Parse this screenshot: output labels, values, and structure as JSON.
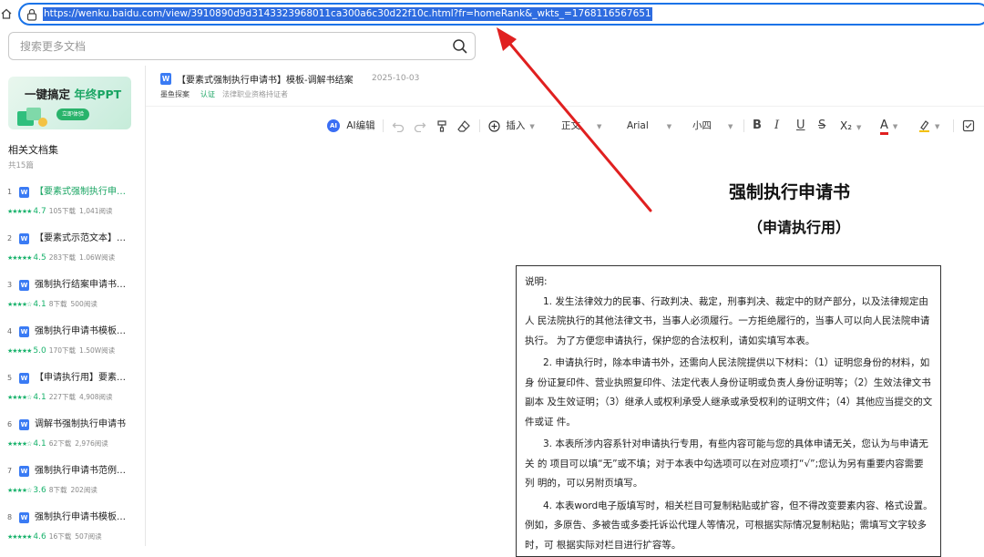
{
  "browser": {
    "url": "https://wenku.baidu.com/view/3910890d9d3143323968011ca300a6c30d22f10c.html?fr=homeRank&_wkts_=1768116567651"
  },
  "search": {
    "placeholder": "搜索更多文档"
  },
  "sidebar": {
    "banner": {
      "title_prefix": "一键搞定 ",
      "title_accent": "年终PPT",
      "button": "立即体验"
    },
    "related_title": "相关文档集",
    "related_count": "共15篇",
    "items": [
      {
        "num": "1",
        "title": "【要素式强制执行申…",
        "stars": "★★★★★",
        "rating": "4.7",
        "downloads": "105下载",
        "reads": "1,041阅读",
        "active": true
      },
      {
        "num": "2",
        "title": "【要素式示范文本】…",
        "stars": "★★★★★",
        "rating": "4.5",
        "downloads": "283下载",
        "reads": "1.06W阅读",
        "active": false
      },
      {
        "num": "3",
        "title": "强制执行结案申请书…",
        "stars": "★★★★☆",
        "rating": "4.1",
        "downloads": "8下载",
        "reads": "500阅读",
        "active": false
      },
      {
        "num": "4",
        "title": "强制执行申请书模板…",
        "stars": "★★★★★",
        "rating": "5.0",
        "downloads": "170下载",
        "reads": "1.50W阅读",
        "active": false
      },
      {
        "num": "5",
        "title": "【申请执行用】要素…",
        "stars": "★★★★☆",
        "rating": "4.1",
        "downloads": "227下载",
        "reads": "4,908阅读",
        "active": false
      },
      {
        "num": "6",
        "title": "调解书强制执行申请书",
        "stars": "★★★★☆",
        "rating": "4.1",
        "downloads": "62下载",
        "reads": "2,976阅读",
        "active": false
      },
      {
        "num": "7",
        "title": "强制执行申请书范例…",
        "stars": "★★★★☆",
        "rating": "3.6",
        "downloads": "8下载",
        "reads": "202阅读",
        "active": false
      },
      {
        "num": "8",
        "title": "强制执行申请书模板…",
        "stars": "★★★★★",
        "rating": "4.6",
        "downloads": "16下载",
        "reads": "507阅读",
        "active": false
      }
    ]
  },
  "doc_header": {
    "type_icon": "W",
    "title": "【要素式强制执行申请书】模板-调解书结案",
    "date": "2025-10-03",
    "author": "墨鱼探案",
    "badge": "认证",
    "cert": "法律职业资格持证者"
  },
  "toolbar": {
    "ai_label": "AI编辑",
    "insert": "插入",
    "style": "正文",
    "font": "Arial",
    "size": "小四",
    "bold": "B",
    "italic": "I",
    "underline": "U",
    "strike": "S",
    "subscript": "X₂",
    "font_color": "A"
  },
  "document": {
    "heading": "强制执行申请书",
    "subheading": "（申请执行用）",
    "instructions_label": "说明:",
    "paragraphs": [
      "1. 发生法律效力的民事、行政判决、裁定，刑事判决、裁定中的财产部分，以及法律规定由人  民法院执行的其他法律文书，当事人必须履行。一方拒绝履行的，当事人可以向人民法院申请执行。 为了方便您申请执行，保护您的合法权利，请如实填写本表。",
      "2. 申请执行时，除本申请书外，还需向人民法院提供以下材料：（1）证明您身份的材料，如身 份证复印件、营业执照复印件、法定代表人身份证明或负责人身份证明等；（2）生效法律文书副本 及生效证明；（3）继承人或权利承受人继承或承受权利的证明文件；（4）其他应当提交的文件或证 件。",
      "3. 本表所涉内容系针对申请执行专用，有些内容可能与您的具体申请无关，您认为与申请无关 的 项目可以填“无”或不填；对于本表中勾选项可以在对应项打“√”;您认为另有重要内容需要列 明的，可以另附页填写。",
      "4. 本表word电子版填写时，相关栏目可复制粘贴或扩容，但不得改变要素内容、格式设置。例如，多原告、多被告或多委托诉讼代理人等情况，可根据实际情况复制粘贴；需填写文字较多时，可 根据实际对栏目进行扩容等。"
    ]
  },
  "colors": {
    "accent_green": "#1aa563",
    "url_highlight": "#2e6ce0",
    "annotation_red": "#e02020"
  },
  "icons": [
    "home-icon",
    "lock-icon",
    "search-icon",
    "word-doc-icon",
    "ai-edit-icon",
    "undo-icon",
    "redo-icon",
    "format-painter-icon",
    "eraser-icon",
    "insert-plus-icon",
    "highlight-icon",
    "checkbox-icon"
  ]
}
